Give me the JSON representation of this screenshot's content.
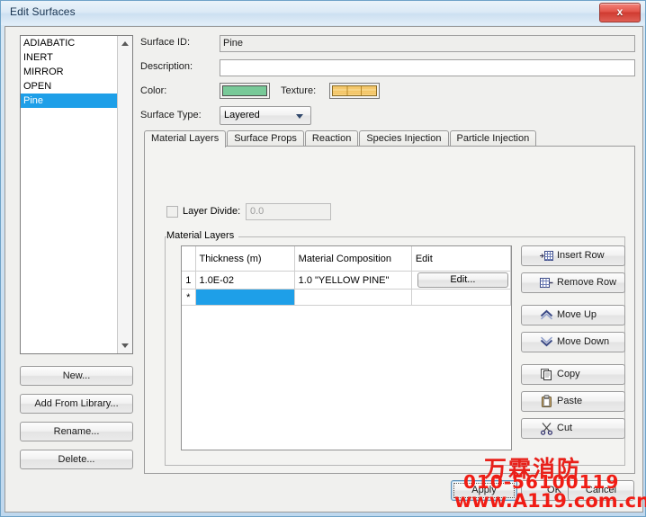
{
  "window": {
    "title": "Edit Surfaces",
    "close_label": "x"
  },
  "surface_list": {
    "items": [
      {
        "label": "ADIABATIC",
        "selected": false
      },
      {
        "label": "INERT",
        "selected": false
      },
      {
        "label": "MIRROR",
        "selected": false
      },
      {
        "label": "OPEN",
        "selected": false
      },
      {
        "label": "Pine",
        "selected": true
      }
    ]
  },
  "left_buttons": [
    {
      "label": "New..."
    },
    {
      "label": "Add From Library..."
    },
    {
      "label": "Rename..."
    },
    {
      "label": "Delete..."
    }
  ],
  "fields": {
    "surface_id_label": "Surface ID:",
    "surface_id_value": "Pine",
    "description_label": "Description:",
    "description_value": "",
    "description_placeholder": "",
    "color_label": "Color:",
    "color_value": "#78c998",
    "texture_label": "Texture:",
    "texture_value": "#f2c263",
    "surface_type_label": "Surface Type:",
    "surface_type_value": "Layered",
    "surface_type_options": [
      "Layered"
    ]
  },
  "tabs": [
    {
      "label": "Material Layers",
      "active": true
    },
    {
      "label": "Surface Props",
      "active": false
    },
    {
      "label": "Reaction",
      "active": false
    },
    {
      "label": "Species Injection",
      "active": false
    },
    {
      "label": "Particle Injection",
      "active": false
    }
  ],
  "material_layers": {
    "layer_divide_label": "Layer Divide:",
    "layer_divide_checked": false,
    "layer_divide_value": "0.0",
    "group_label": "Material Layers",
    "grid": {
      "columns": [
        "",
        "Thickness (m)",
        "Material Composition",
        "Edit"
      ],
      "rows": [
        {
          "row_header": "1",
          "thickness": "1.0E-02",
          "composition": "1.0 \"YELLOW PINE\"",
          "edit_label": "Edit...",
          "selected": false
        },
        {
          "row_header": "*",
          "thickness": "",
          "composition": "",
          "edit_label": "",
          "selected": true
        }
      ]
    },
    "actions": [
      {
        "label": "Insert Row",
        "icon": "insert-row-icon"
      },
      {
        "label": "Remove Row",
        "icon": "remove-row-icon"
      },
      {
        "label": "Move Up",
        "icon": "chevron-up-icon"
      },
      {
        "label": "Move Down",
        "icon": "chevron-down-icon"
      },
      {
        "label": "Copy",
        "icon": "copy-icon"
      },
      {
        "label": "Paste",
        "icon": "paste-icon"
      },
      {
        "label": "Cut",
        "icon": "scissors-icon"
      }
    ]
  },
  "dialog_buttons": [
    {
      "label": "Apply",
      "focused": true
    },
    {
      "label": "OK",
      "focused": false
    },
    {
      "label": "Cancel",
      "focused": false
    }
  ],
  "watermark": {
    "company": "万霖消防",
    "phone": "010-56100119",
    "url": "www.A119.com.cn",
    "color": "#f01c14"
  }
}
